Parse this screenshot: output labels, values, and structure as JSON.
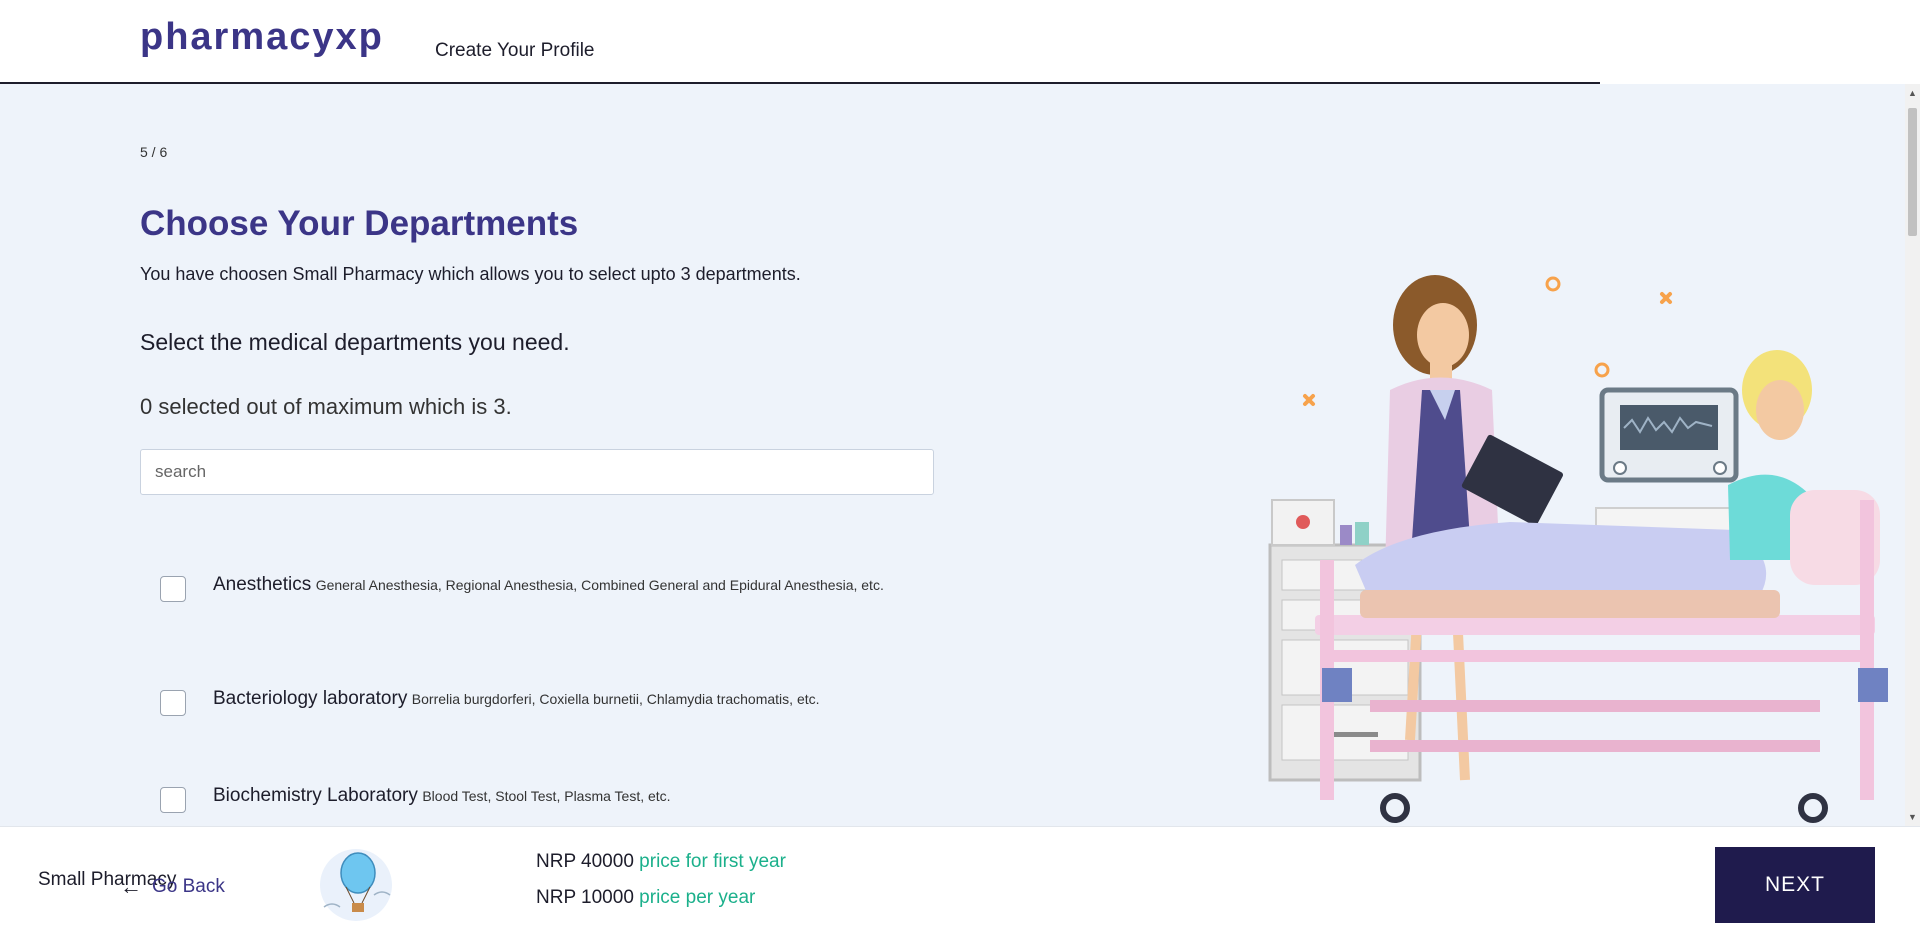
{
  "header": {
    "brand": "pharmacyxp",
    "title": "Create Your Profile"
  },
  "main": {
    "step": "5 / 6",
    "heading": "Choose Your Departments",
    "subtext": "You have choosen Small Pharmacy which allows you to select upto 3 departments.",
    "question": "Select the medical departments you need.",
    "counter": "0 selected out of maximum which is 3.",
    "search_placeholder": "search",
    "departments": [
      {
        "name": "Anesthetics",
        "desc": "General Anesthesia, Regional Anesthesia, Combined General and Epidural Anesthesia, etc.",
        "checked": false
      },
      {
        "name": "Bacteriology laboratory",
        "desc": "Borrelia burgdorferi, Coxiella burnetii, Chlamydia trachomatis, etc.",
        "checked": false
      },
      {
        "name": "Biochemistry Laboratory",
        "desc": "Blood Test, Stool Test, Plasma Test, etc.",
        "checked": false
      }
    ]
  },
  "footer": {
    "plan": "Small Pharmacy",
    "back_label": "Go Back",
    "price_first_amount": "NRP 40000",
    "price_first_note": "price for first year",
    "price_yearly_amount": "NRP 10000",
    "price_yearly_note": "price per year",
    "next_label": "NEXT"
  },
  "colors": {
    "brand": "#3b3587",
    "accent_green": "#1bb08b",
    "next_bg": "#1f1b4d",
    "page_bg": "#eef3fa"
  }
}
